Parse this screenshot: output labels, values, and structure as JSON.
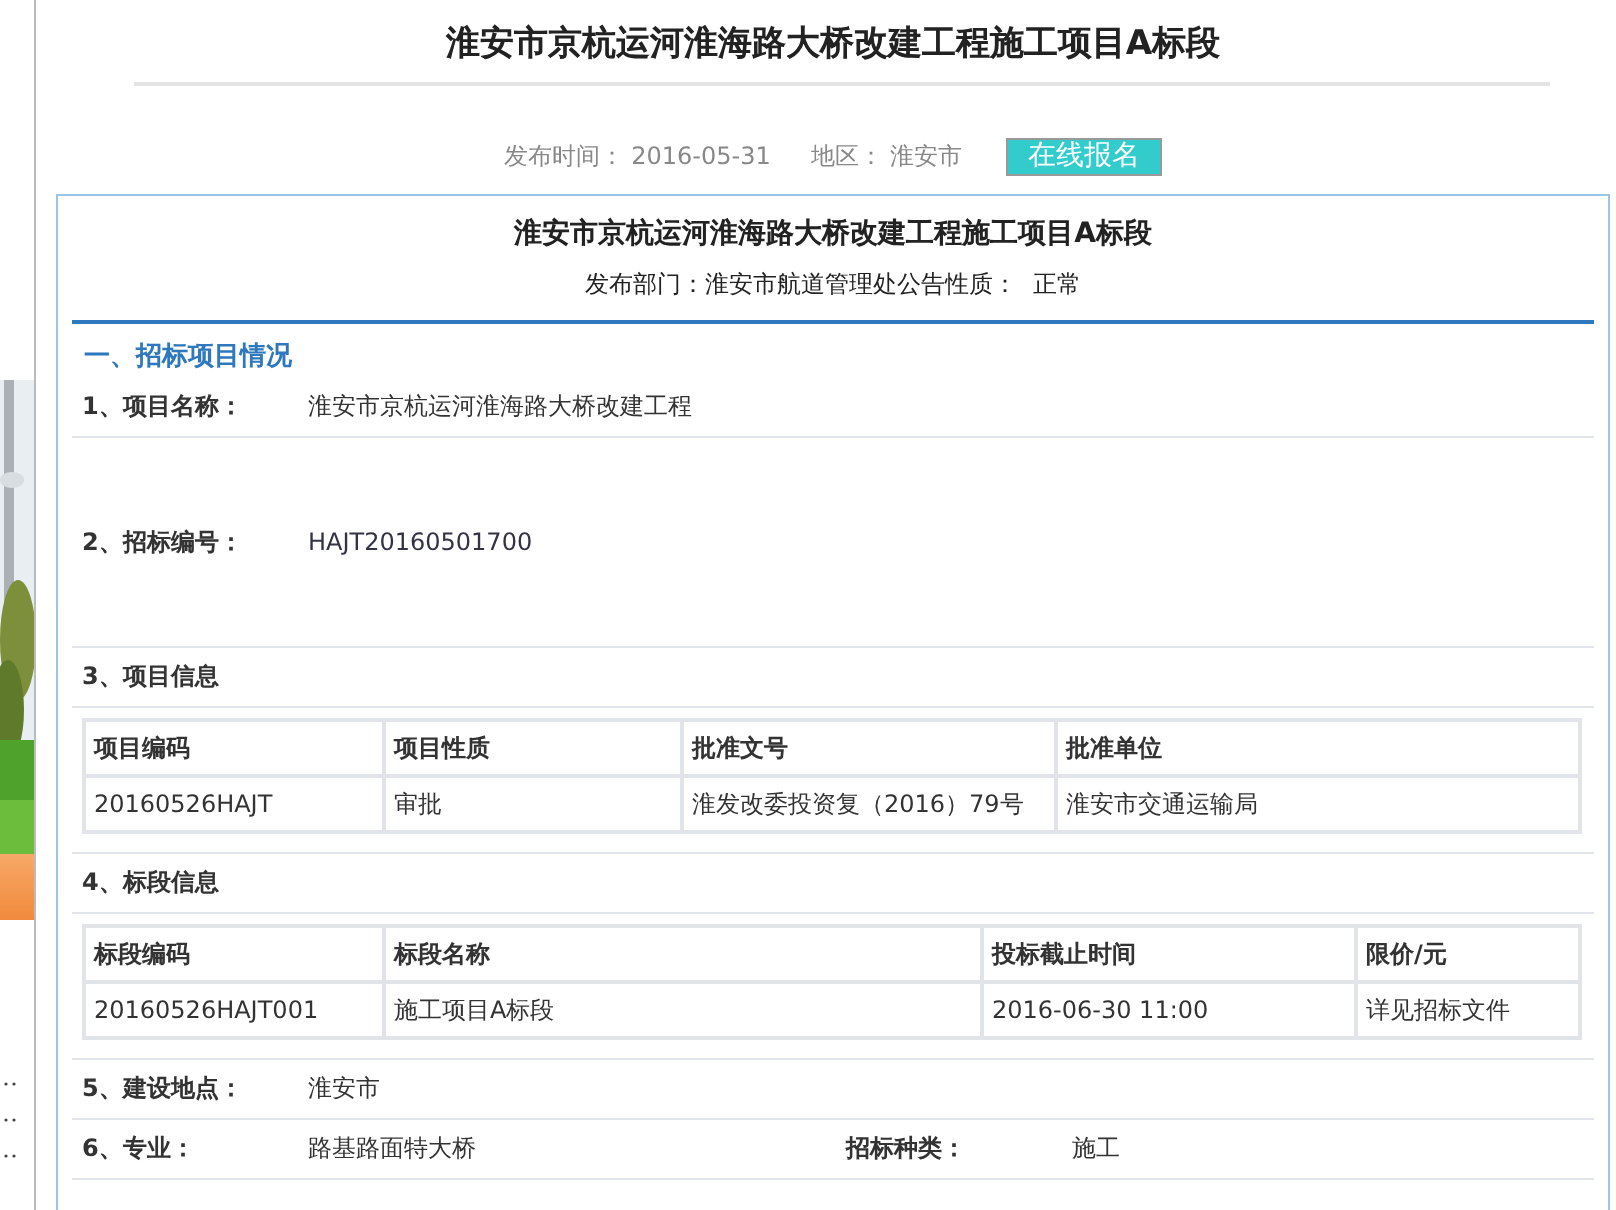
{
  "page_title": "淮安市京杭运河淮海路大桥改建工程施工项目A标段",
  "meta": [
    {
      "label": "发布时间：",
      "value": "2016-05-31"
    },
    {
      "label": "地区：",
      "value": "淮安市"
    }
  ],
  "signup_button": "在线报名",
  "notice": {
    "title": "淮安市京杭运河淮海路大桥改建工程施工项目A标段",
    "department_line": "发布部门：淮安市航道管理处公告性质：  正常"
  },
  "section_heading": "一、招标项目情况",
  "rows": [
    {
      "kind": "field",
      "label": "1、项目名称：",
      "value": "淮安市京杭运河淮海路大桥改建工程"
    },
    {
      "kind": "tall_field",
      "label": "2、招标编号：",
      "value": "HAJT20160501700"
    },
    {
      "kind": "table",
      "label": "3、项目信息",
      "columns": [
        "项目编码",
        "项目性质",
        "批准文号",
        "批准单位"
      ],
      "cells": [
        "20160526HAJT",
        "审批",
        "淮发改委投资复（2016）79号",
        "淮安市交通运输局"
      ]
    },
    {
      "kind": "table",
      "label": "4、标段信息",
      "columns": [
        "标段编码",
        "标段名称",
        "投标截止时间",
        "限价/元"
      ],
      "cells": [
        "20160526HAJT001",
        "施工项目A标段",
        "2016-06-30 11:00",
        "详见招标文件"
      ]
    },
    {
      "kind": "field",
      "label": "5、建设地点：",
      "value": "淮安市"
    },
    {
      "kind": "pair",
      "label": "6、专业：",
      "value": "路基路面特大桥",
      "label2": "招标种类：",
      "value2": "施工"
    }
  ]
}
